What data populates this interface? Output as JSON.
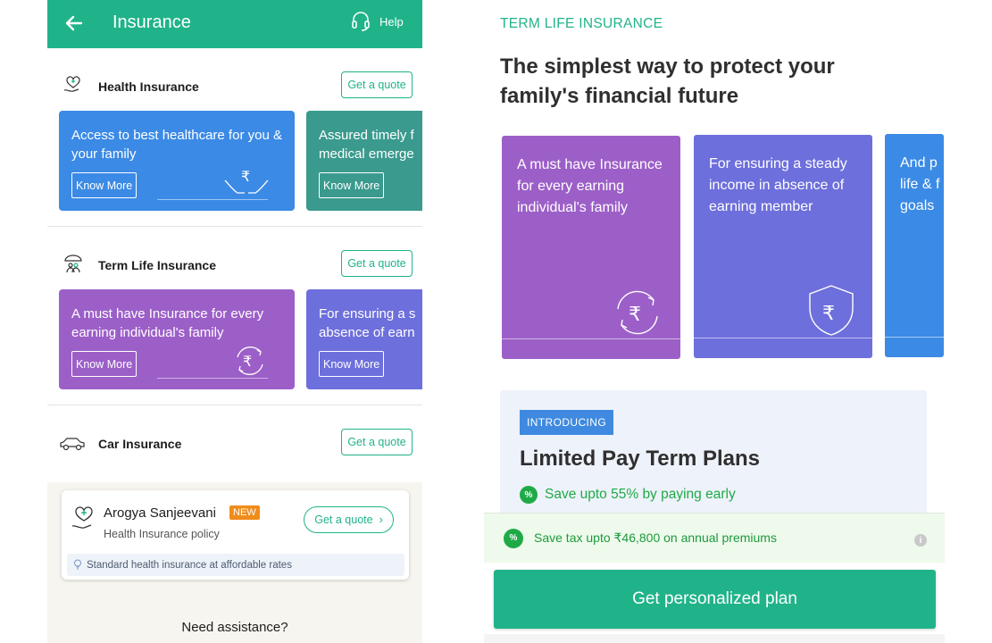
{
  "left": {
    "header": {
      "title": "Insurance",
      "help_label": "Help"
    },
    "sections": [
      {
        "title": "Health Insurance",
        "quote_label": "Get a quote",
        "cards": [
          {
            "text": "Access to best healthcare for you & your family",
            "button": "Know More"
          },
          {
            "text": "Assured timely f medical emerge",
            "button": "Know More"
          }
        ]
      },
      {
        "title": "Term Life Insurance",
        "quote_label": "Get a quote",
        "cards": [
          {
            "text": "A must have Insurance for every earning individual's family",
            "button": "Know More"
          },
          {
            "text": "For ensuring a s absence of earn",
            "button": "Know More"
          }
        ]
      },
      {
        "title": "Car Insurance",
        "quote_label": "Get a quote"
      }
    ],
    "arogya": {
      "name": "Arogya Sanjeevani",
      "badge": "NEW",
      "subtitle": "Health Insurance policy",
      "quote_label": "Get a quote",
      "info": "Standard health insurance at affordable rates"
    },
    "assist": "Need assistance?"
  },
  "right": {
    "eyebrow": "TERM LIFE INSURANCE",
    "headline": "The simplest way to protect your family's financial future",
    "cards": [
      {
        "text": "A must have Insurance for every earning individual's family"
      },
      {
        "text": "For ensuring a steady income in absence of earning member"
      },
      {
        "text": "And p life & f goals"
      }
    ],
    "intro": {
      "badge": "INTRODUCING",
      "title": "Limited Pay Term Plans",
      "save_text": "Save upto 55% by paying early"
    },
    "tax_text": "Save tax upto ₹46,800 on annual premiums",
    "cta": "Get personalized plan"
  },
  "colors": {
    "brand": "#20b38a",
    "blue_card": "#3b8ae6",
    "teal_card": "#3a9a8e",
    "purple_card": "#9c5fc8",
    "indigo_card": "#6d6fdc",
    "green_text": "#1faa47"
  },
  "icons": [
    "back-arrow-icon",
    "headset-icon",
    "health-icon",
    "umbrella-family-icon",
    "car-icon",
    "rupee-hands-icon",
    "rupee-cycle-icon",
    "shield-rupee-icon",
    "bulb-icon",
    "chevron-right-icon",
    "percent-icon",
    "info-icon"
  ]
}
